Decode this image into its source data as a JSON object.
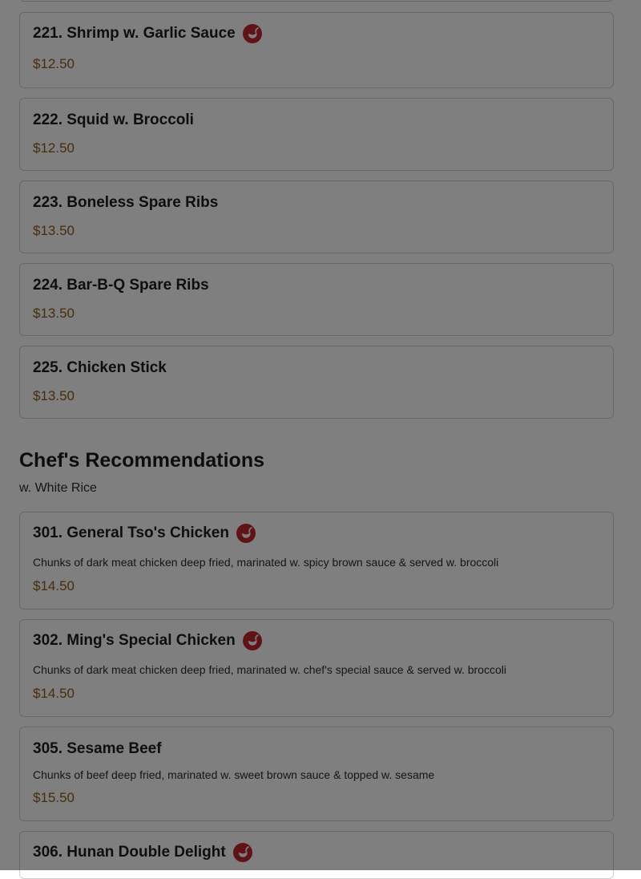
{
  "top_items": [
    {
      "name": "221. Shrimp w. Garlic Sauce",
      "price": "$12.50",
      "spicy": true
    },
    {
      "name": "222. Squid w. Broccoli",
      "price": "$12.50",
      "spicy": false
    },
    {
      "name": "223. Boneless Spare Ribs",
      "price": "$13.50",
      "spicy": false
    },
    {
      "name": "224. Bar-B-Q Spare Ribs",
      "price": "$13.50",
      "spicy": false
    },
    {
      "name": "225. Chicken Stick",
      "price": "$13.50",
      "spicy": false
    }
  ],
  "section": {
    "title": "Chef's Recommendations",
    "subtitle": "w. White Rice"
  },
  "chef_items": [
    {
      "name": "301. General Tso's Chicken",
      "description": "Chunks of dark meat chicken deep fried, marinated w. spicy brown sauce & served w. broccoli",
      "price": "$14.50",
      "spicy": true
    },
    {
      "name": "302. Ming's Special Chicken",
      "description": "Chunks of dark meat chicken deep fried, marinated w. chef's special sauce & served w. broccoli",
      "price": "$14.50",
      "spicy": true
    },
    {
      "name": "305. Sesame Beef",
      "description": "Chunks of beef deep fried, marinated w. sweet brown sauce & topped w. sesame",
      "price": "$15.50",
      "spicy": false
    },
    {
      "name": "306. Hunan Double Delight",
      "spicy": true
    }
  ],
  "icons": {
    "spicy": "chili-pepper-icon"
  },
  "colors": {
    "price": "#8a5a1a",
    "spicy_badge": "#c0262c",
    "overlay": "rgba(0,0,0,0.5)"
  }
}
